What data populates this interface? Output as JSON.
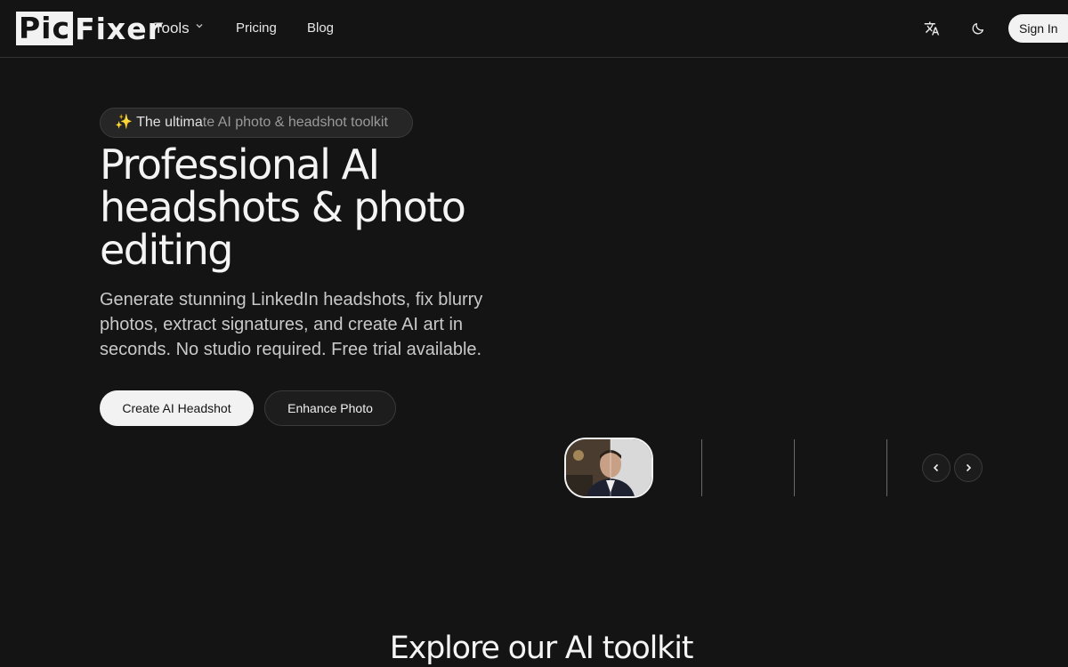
{
  "nav": {
    "logo_left": "Pic",
    "logo_right": "Fixer",
    "tools_label": "Tools",
    "pricing_label": "Pricing",
    "blog_label": "Blog",
    "signin_label": "Sign In",
    "icons": [
      "translate-icon",
      "moon-icon",
      "chevron-down-icon"
    ]
  },
  "hero": {
    "badge_emoji": "✨",
    "badge_bright": "The ultima",
    "badge_dim": "te AI photo & headshot toolkit",
    "headline_line1": "Professional AI",
    "headline_line2": "headshots & photo",
    "headline_line3": "editing",
    "subtext": "Generate stunning LinkedIn headshots, fix blurry photos, extract signatures, and create AI art in seconds. No studio required. Free trial available.",
    "primary_cta": "Create AI Headshot",
    "secondary_cta": "Enhance Photo"
  },
  "carousel": {
    "icons": [
      "chevron-left-icon",
      "chevron-right-icon"
    ]
  },
  "section": {
    "title": "Explore our AI toolkit"
  },
  "colors": {
    "background": "#141414",
    "text": "#f2f2f2",
    "button_light": "#f2f2f2",
    "border": "#333333"
  }
}
